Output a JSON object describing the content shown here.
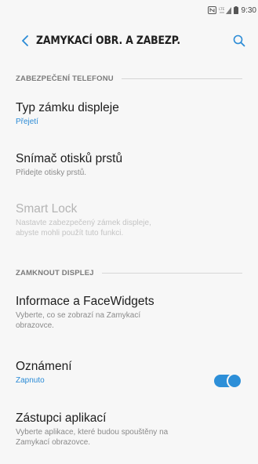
{
  "status_bar": {
    "time": "9:30"
  },
  "app_bar": {
    "title": "ZAMYKACÍ OBR. A ZABEZP."
  },
  "sections": [
    {
      "header": "ZABEZPEČENÍ TELEFONU",
      "items": [
        {
          "title": "Typ zámku displeje",
          "subtitle": "Přejetí"
        },
        {
          "title": "Snímač otisků prstů",
          "subtitle": "Přidejte otisky prstů."
        },
        {
          "title": "Smart Lock",
          "subtitle_line1": "Nastavte zabezpečený zámek displeje,",
          "subtitle_line2": "abyste mohli použít tuto funkci."
        }
      ]
    },
    {
      "header": "ZAMKNOUT DISPLEJ",
      "items": [
        {
          "title": "Informace a FaceWidgets",
          "subtitle_line1": "Vyberte, co se zobrazí na Zamykací",
          "subtitle_line2": "obrazovce."
        },
        {
          "title": "Oznámení",
          "subtitle": "Zapnuto",
          "toggle_on": true
        },
        {
          "title": "Zástupci aplikací",
          "subtitle_line1": "Vyberte aplikace, které budou spouštěny na",
          "subtitle_line2": "Zamykací obrazovce."
        }
      ]
    }
  ],
  "colors": {
    "accent": "#2b8bd6",
    "background": "#f7f7f7",
    "toggle": "#2d8fd8"
  }
}
